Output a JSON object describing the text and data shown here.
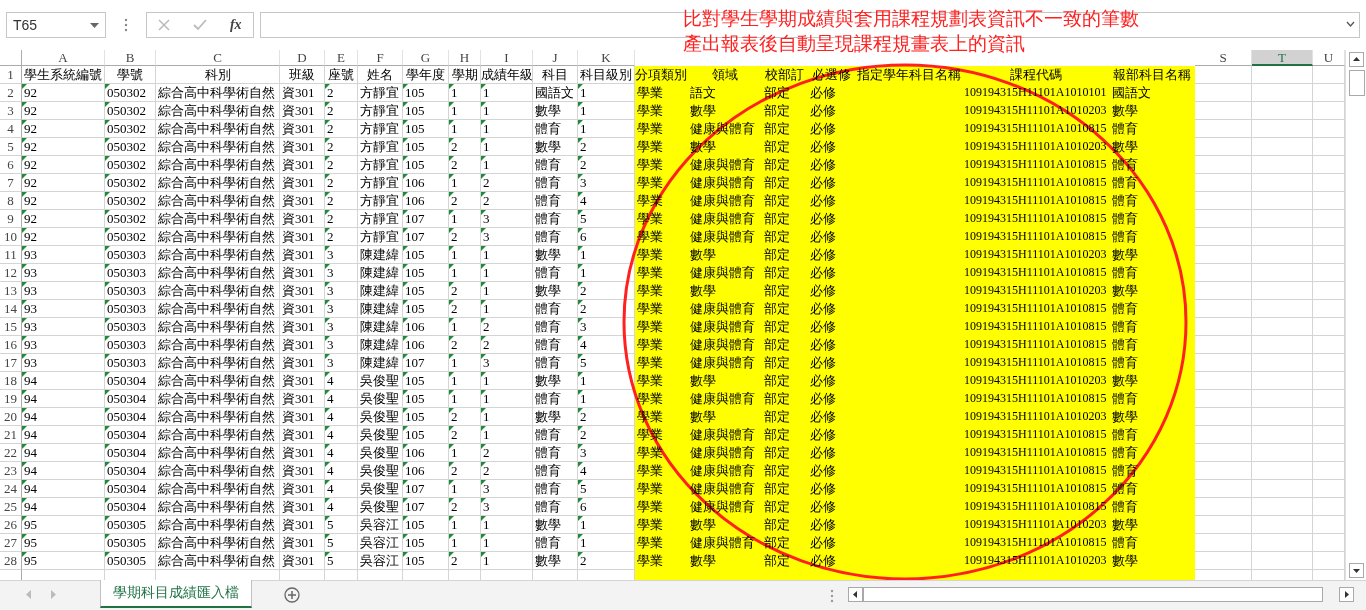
{
  "name_box": "T65",
  "function_label": "fx",
  "annotation": {
    "lines": [
      "比對學生學期成績與套用課程規劃表資訊不一致的筆數",
      "產出報表後自動呈現課程規畫表上的資訊"
    ]
  },
  "columns": [
    {
      "letter": "A",
      "header": "學生系統編號",
      "flag": true,
      "highlight": false,
      "selected": false
    },
    {
      "letter": "B",
      "header": "學號",
      "flag": true,
      "highlight": false,
      "selected": false
    },
    {
      "letter": "C",
      "header": "科別",
      "flag": false,
      "highlight": false,
      "selected": false
    },
    {
      "letter": "D",
      "header": "班級",
      "flag": false,
      "highlight": false,
      "selected": false
    },
    {
      "letter": "E",
      "header": "座號",
      "flag": true,
      "highlight": false,
      "selected": false
    },
    {
      "letter": "F",
      "header": "姓名",
      "flag": false,
      "highlight": false,
      "selected": false
    },
    {
      "letter": "G",
      "header": "學年度",
      "flag": true,
      "highlight": false,
      "selected": false
    },
    {
      "letter": "H",
      "header": "學期",
      "flag": true,
      "highlight": false,
      "selected": false
    },
    {
      "letter": "I",
      "header": "成績年級",
      "flag": true,
      "highlight": false,
      "selected": false
    },
    {
      "letter": "J",
      "header": "科目",
      "flag": false,
      "highlight": false,
      "selected": false
    },
    {
      "letter": "K",
      "header": "科目級別",
      "flag": true,
      "highlight": false,
      "selected": false
    },
    {
      "header": "分項類別",
      "flag": false,
      "highlight": true,
      "selected": false
    },
    {
      "header": "領域",
      "flag": false,
      "highlight": true,
      "selected": false
    },
    {
      "header": "校部訂",
      "flag": false,
      "highlight": true,
      "selected": false
    },
    {
      "header": "必選修",
      "flag": false,
      "highlight": true,
      "selected": false
    },
    {
      "header": "指定學年科目名稱",
      "flag": false,
      "highlight": true,
      "selected": false
    },
    {
      "header": "課程代碼",
      "flag": false,
      "highlight": true,
      "selected": false
    },
    {
      "header": "報部科目名稱",
      "flag": false,
      "highlight": true,
      "selected": false
    },
    {
      "letter": "S",
      "flag": false,
      "highlight": false,
      "selected": false
    },
    {
      "letter": "T",
      "flag": false,
      "highlight": false,
      "selected": true
    },
    {
      "letter": "U",
      "flag": false,
      "highlight": false,
      "selected": false
    }
  ],
  "header_row_number": "1",
  "rows": [
    {
      "number": "2",
      "cells": [
        "92",
        "050302",
        "綜合高中科學術自然",
        "資301",
        "2",
        "方靜宜",
        "105",
        "1",
        "1",
        "國語文",
        "1",
        "學業",
        "語文",
        "部定",
        "必修",
        null,
        "109194315H11101A1010101",
        "國語文"
      ]
    },
    {
      "number": "3",
      "cells": [
        "92",
        "050302",
        "綜合高中科學術自然",
        "資301",
        "2",
        "方靜宜",
        "105",
        "1",
        "1",
        "數學",
        "1",
        "學業",
        "數學",
        "部定",
        "必修",
        null,
        "109194315H11101A1010203",
        "數學"
      ]
    },
    {
      "number": "4",
      "cells": [
        "92",
        "050302",
        "綜合高中科學術自然",
        "資301",
        "2",
        "方靜宜",
        "105",
        "1",
        "1",
        "體育",
        "1",
        "學業",
        "健康與體育",
        "部定",
        "必修",
        null,
        "109194315H11101A1010815",
        "體育"
      ]
    },
    {
      "number": "5",
      "cells": [
        "92",
        "050302",
        "綜合高中科學術自然",
        "資301",
        "2",
        "方靜宜",
        "105",
        "2",
        "1",
        "數學",
        "2",
        "學業",
        "數學",
        "部定",
        "必修",
        null,
        "109194315H11101A1010203",
        "數學"
      ]
    },
    {
      "number": "6",
      "cells": [
        "92",
        "050302",
        "綜合高中科學術自然",
        "資301",
        "2",
        "方靜宜",
        "105",
        "2",
        "1",
        "體育",
        "2",
        "學業",
        "健康與體育",
        "部定",
        "必修",
        null,
        "109194315H11101A1010815",
        "體育"
      ]
    },
    {
      "number": "7",
      "cells": [
        "92",
        "050302",
        "綜合高中科學術自然",
        "資301",
        "2",
        "方靜宜",
        "106",
        "1",
        "2",
        "體育",
        "3",
        "學業",
        "健康與體育",
        "部定",
        "必修",
        null,
        "109194315H11101A1010815",
        "體育"
      ]
    },
    {
      "number": "8",
      "cells": [
        "92",
        "050302",
        "綜合高中科學術自然",
        "資301",
        "2",
        "方靜宜",
        "106",
        "2",
        "2",
        "體育",
        "4",
        "學業",
        "健康與體育",
        "部定",
        "必修",
        null,
        "109194315H11101A1010815",
        "體育"
      ]
    },
    {
      "number": "9",
      "cells": [
        "92",
        "050302",
        "綜合高中科學術自然",
        "資301",
        "2",
        "方靜宜",
        "107",
        "1",
        "3",
        "體育",
        "5",
        "學業",
        "健康與體育",
        "部定",
        "必修",
        null,
        "109194315H11101A1010815",
        "體育"
      ]
    },
    {
      "number": "10",
      "cells": [
        "92",
        "050302",
        "綜合高中科學術自然",
        "資301",
        "2",
        "方靜宜",
        "107",
        "2",
        "3",
        "體育",
        "6",
        "學業",
        "健康與體育",
        "部定",
        "必修",
        null,
        "109194315H11101A1010815",
        "體育"
      ]
    },
    {
      "number": "11",
      "cells": [
        "93",
        "050303",
        "綜合高中科學術自然",
        "資301",
        "3",
        "陳建緯",
        "105",
        "1",
        "1",
        "數學",
        "1",
        "學業",
        "數學",
        "部定",
        "必修",
        null,
        "109194315H11101A1010203",
        "數學"
      ]
    },
    {
      "number": "12",
      "cells": [
        "93",
        "050303",
        "綜合高中科學術自然",
        "資301",
        "3",
        "陳建緯",
        "105",
        "1",
        "1",
        "體育",
        "1",
        "學業",
        "健康與體育",
        "部定",
        "必修",
        null,
        "109194315H11101A1010815",
        "體育"
      ]
    },
    {
      "number": "13",
      "cells": [
        "93",
        "050303",
        "綜合高中科學術自然",
        "資301",
        "3",
        "陳建緯",
        "105",
        "2",
        "1",
        "數學",
        "2",
        "學業",
        "數學",
        "部定",
        "必修",
        null,
        "109194315H11101A1010203",
        "數學"
      ]
    },
    {
      "number": "14",
      "cells": [
        "93",
        "050303",
        "綜合高中科學術自然",
        "資301",
        "3",
        "陳建緯",
        "105",
        "2",
        "1",
        "體育",
        "2",
        "學業",
        "健康與體育",
        "部定",
        "必修",
        null,
        "109194315H11101A1010815",
        "體育"
      ]
    },
    {
      "number": "15",
      "cells": [
        "93",
        "050303",
        "綜合高中科學術自然",
        "資301",
        "3",
        "陳建緯",
        "106",
        "1",
        "2",
        "體育",
        "3",
        "學業",
        "健康與體育",
        "部定",
        "必修",
        null,
        "109194315H11101A1010815",
        "體育"
      ]
    },
    {
      "number": "16",
      "cells": [
        "93",
        "050303",
        "綜合高中科學術自然",
        "資301",
        "3",
        "陳建緯",
        "106",
        "2",
        "2",
        "體育",
        "4",
        "學業",
        "健康與體育",
        "部定",
        "必修",
        null,
        "109194315H11101A1010815",
        "體育"
      ]
    },
    {
      "number": "17",
      "cells": [
        "93",
        "050303",
        "綜合高中科學術自然",
        "資301",
        "3",
        "陳建緯",
        "107",
        "1",
        "3",
        "體育",
        "5",
        "學業",
        "健康與體育",
        "部定",
        "必修",
        null,
        "109194315H11101A1010815",
        "體育"
      ]
    },
    {
      "number": "18",
      "cells": [
        "94",
        "050304",
        "綜合高中科學術自然",
        "資301",
        "4",
        "吳俊聖",
        "105",
        "1",
        "1",
        "數學",
        "1",
        "學業",
        "數學",
        "部定",
        "必修",
        null,
        "109194315H11101A1010203",
        "數學"
      ]
    },
    {
      "number": "19",
      "cells": [
        "94",
        "050304",
        "綜合高中科學術自然",
        "資301",
        "4",
        "吳俊聖",
        "105",
        "1",
        "1",
        "體育",
        "1",
        "學業",
        "健康與體育",
        "部定",
        "必修",
        null,
        "109194315H11101A1010815",
        "體育"
      ]
    },
    {
      "number": "20",
      "cells": [
        "94",
        "050304",
        "綜合高中科學術自然",
        "資301",
        "4",
        "吳俊聖",
        "105",
        "2",
        "1",
        "數學",
        "2",
        "學業",
        "數學",
        "部定",
        "必修",
        null,
        "109194315H11101A1010203",
        "數學"
      ]
    },
    {
      "number": "21",
      "cells": [
        "94",
        "050304",
        "綜合高中科學術自然",
        "資301",
        "4",
        "吳俊聖",
        "105",
        "2",
        "1",
        "體育",
        "2",
        "學業",
        "健康與體育",
        "部定",
        "必修",
        null,
        "109194315H11101A1010815",
        "體育"
      ]
    },
    {
      "number": "22",
      "cells": [
        "94",
        "050304",
        "綜合高中科學術自然",
        "資301",
        "4",
        "吳俊聖",
        "106",
        "1",
        "2",
        "體育",
        "3",
        "學業",
        "健康與體育",
        "部定",
        "必修",
        null,
        "109194315H11101A1010815",
        "體育"
      ]
    },
    {
      "number": "23",
      "cells": [
        "94",
        "050304",
        "綜合高中科學術自然",
        "資301",
        "4",
        "吳俊聖",
        "106",
        "2",
        "2",
        "體育",
        "4",
        "學業",
        "健康與體育",
        "部定",
        "必修",
        null,
        "109194315H11101A1010815",
        "體育"
      ]
    },
    {
      "number": "24",
      "cells": [
        "94",
        "050304",
        "綜合高中科學術自然",
        "資301",
        "4",
        "吳俊聖",
        "107",
        "1",
        "3",
        "體育",
        "5",
        "學業",
        "健康與體育",
        "部定",
        "必修",
        null,
        "109194315H11101A1010815",
        "體育"
      ]
    },
    {
      "number": "25",
      "cells": [
        "94",
        "050304",
        "綜合高中科學術自然",
        "資301",
        "4",
        "吳俊聖",
        "107",
        "2",
        "3",
        "體育",
        "6",
        "學業",
        "健康與體育",
        "部定",
        "必修",
        null,
        "109194315H11101A1010815",
        "體育"
      ]
    },
    {
      "number": "26",
      "cells": [
        "95",
        "050305",
        "綜合高中科學術自然",
        "資301",
        "5",
        "吳容江",
        "105",
        "1",
        "1",
        "數學",
        "1",
        "學業",
        "數學",
        "部定",
        "必修",
        null,
        "109194315H11101A1010203",
        "數學"
      ]
    },
    {
      "number": "27",
      "cells": [
        "95",
        "050305",
        "綜合高中科學術自然",
        "資301",
        "5",
        "吳容江",
        "105",
        "1",
        "1",
        "體育",
        "1",
        "學業",
        "健康與體育",
        "部定",
        "必修",
        null,
        "109194315H11101A1010815",
        "體育"
      ]
    },
    {
      "number": "28",
      "cells": [
        "95",
        "050305",
        "綜合高中科學術自然",
        "資301",
        "5",
        "吳容江",
        "105",
        "2",
        "1",
        "數學",
        "2",
        "學業",
        "數學",
        "部定",
        "必修",
        null,
        "109194315H11101A1010203",
        "數學"
      ]
    }
  ],
  "sheet_tabs": [
    {
      "label": "學期科目成績匯入檔",
      "selected": true
    }
  ]
}
